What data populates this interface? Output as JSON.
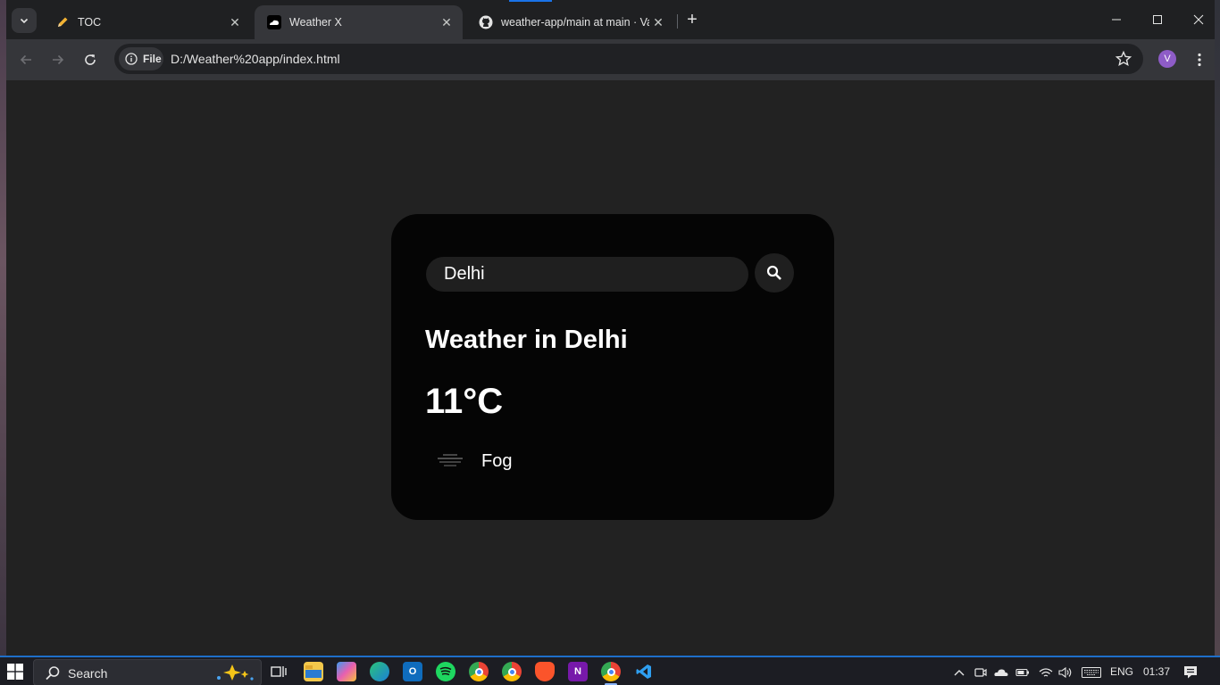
{
  "browser": {
    "tabs": [
      {
        "title": "TOC",
        "icon": "pencil-icon",
        "active": false
      },
      {
        "title": "Weather X",
        "icon": "cloud-icon",
        "active": true
      },
      {
        "title": "weather-app/main at main · Va",
        "icon": "github-icon",
        "active": false
      }
    ],
    "address": {
      "chip_label": "File",
      "url": "D:/Weather%20app/index.html"
    },
    "profile_initial": "V"
  },
  "weather": {
    "search": {
      "value": "Delhi"
    },
    "city_heading": "Weather in Delhi",
    "temperature": "11°C",
    "condition": "Fog",
    "condition_icon": "fog-icon"
  },
  "taskbar": {
    "search_label": "Search",
    "apps": [
      "task-view",
      "file-explorer",
      "copilot",
      "edge",
      "outlook",
      "spotify",
      "chrome",
      "chrome-canary",
      "brave",
      "onenote",
      "chrome-active",
      "vscode"
    ],
    "language": "ENG",
    "time": "01:37"
  },
  "colors": {
    "page_bg": "#222222",
    "card_bg": "#050505",
    "input_bg": "#1f1f1f",
    "text": "#ffffff",
    "accent": "#1a73e8"
  }
}
